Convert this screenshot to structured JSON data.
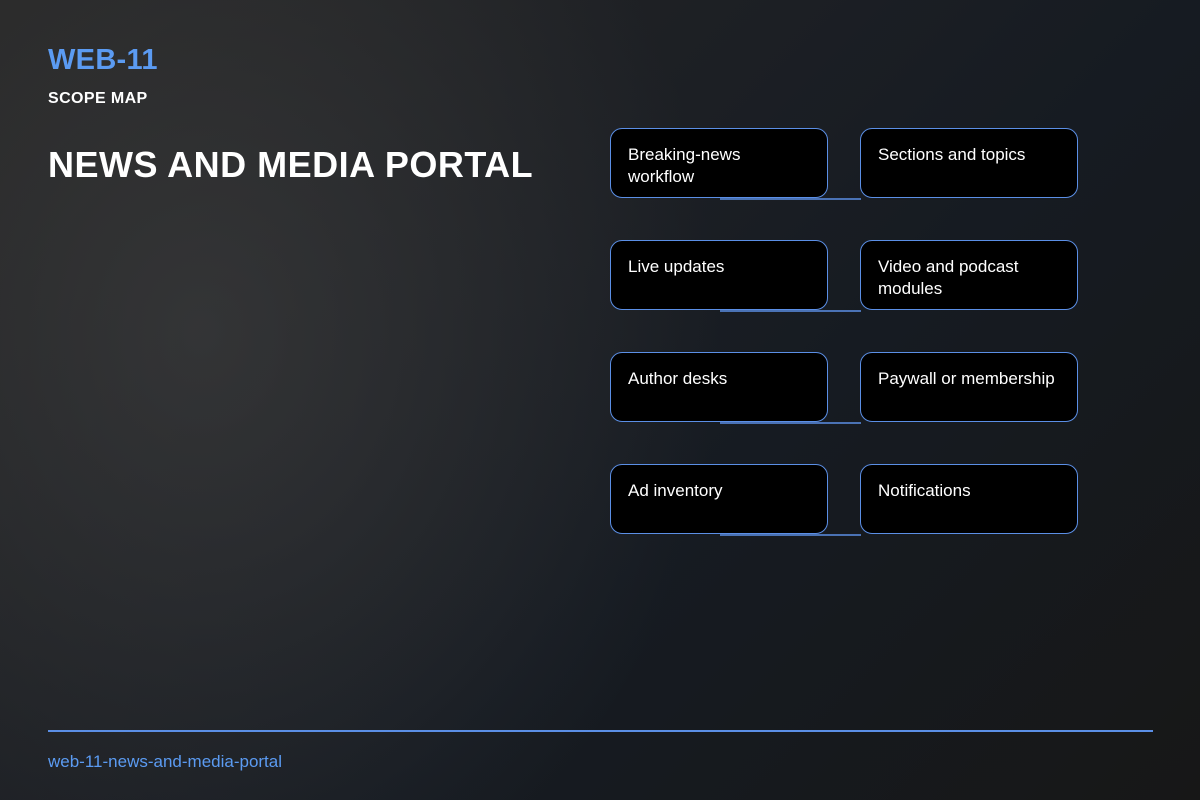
{
  "header": {
    "code": "WEB-11",
    "subtitle": "SCOPE MAP",
    "title": "NEWS AND MEDIA PORTAL"
  },
  "nodes": [
    "Breaking-news workflow",
    "Sections and topics",
    "Live updates",
    "Video and podcast modules",
    "Author desks",
    "Paywall or membership",
    "Ad inventory",
    "Notifications"
  ],
  "footer": {
    "slug": "web-11-news-and-media-portal"
  },
  "colors": {
    "accent": "#5b9bf2",
    "border": "#5b8fe6",
    "node_fill": "#000000",
    "text": "#ffffff"
  }
}
